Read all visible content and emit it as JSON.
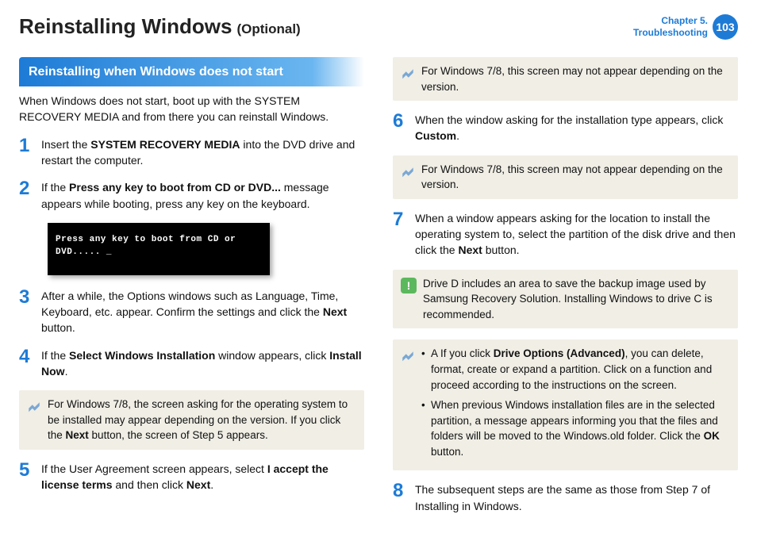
{
  "header": {
    "title": "Reinstalling Windows",
    "subtitle": "(Optional)",
    "chapter_line1": "Chapter 5.",
    "chapter_line2": "Troubleshooting",
    "page_number": "103"
  },
  "section_header": "Reinstalling when Windows does not start",
  "intro": "When Windows does not start, boot up with the SYSTEM RECOVERY MEDIA and from there you can reinstall Windows.",
  "steps": {
    "s1_pre": "Insert the ",
    "s1_bold": "SYSTEM RECOVERY MEDIA",
    "s1_post": " into the DVD drive and restart the computer.",
    "s2_pre": "If the ",
    "s2_bold": "Press any key to boot from CD or DVD...",
    "s2_post": " message appears while booting, press any key on the keyboard.",
    "boot_text": "Press any key to boot from CD or DVD..... _",
    "s3_pre": "After a while, the Options windows such as Language, Time, Keyboard, etc. appear. Confirm the settings and click the ",
    "s3_bold": "Next",
    "s3_post": " button.",
    "s4_pre": "If the ",
    "s4_bold1": "Select Windows Installation",
    "s4_mid": " window appears, click ",
    "s4_bold2": "Install Now",
    "s4_post": ".",
    "note4_pre": "For Windows 7/8, the screen asking for the operating system to be installed may appear depending on the version. If you click the ",
    "note4_bold": "Next",
    "note4_post": " button, the screen of Step 5 appears.",
    "s5_pre": "If the User Agreement screen appears, select ",
    "s5_bold1": "I accept the license terms",
    "s5_mid": " and then click ",
    "s5_bold2": "Next",
    "s5_post": ".",
    "note_top": "For Windows 7/8, this screen may not appear depending on the version.",
    "s6_pre": "When the window asking for the installation type appears, click ",
    "s6_bold": "Custom",
    "s6_post": ".",
    "note6": "For Windows 7/8, this screen may not appear depending on the version.",
    "s7_pre": "When a window appears asking for the location to install the operating system to, select the partition of the disk drive and then click the ",
    "s7_bold": "Next",
    "s7_post": " button.",
    "caution": "Drive D includes an area to save the backup image used by Samsung Recovery Solution. Installing Windows to drive C is recommended.",
    "noteA_pre": "A If you click ",
    "noteA_bold": "Drive Options (Advanced)",
    "noteA_post": ", you can delete, format, create or expand a partition. Click on a function and proceed according to the instructions on the screen.",
    "noteB_pre": "When previous Windows installation files are in the selected partition, a message appears informing you that the files and folders will be moved to the Windows.old folder. Click the ",
    "noteB_bold": "OK",
    "noteB_post": " button.",
    "s8": "The subsequent steps are the same as those from Step 7 of Installing in Windows."
  }
}
